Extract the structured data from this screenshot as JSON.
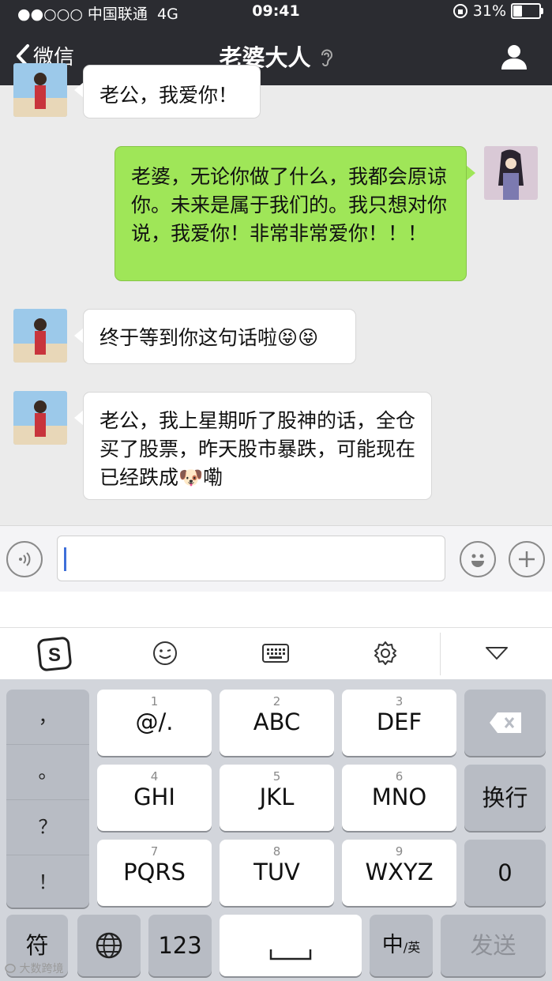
{
  "status_bar": {
    "carrier": "●●○○○ 中国联通",
    "network": "4G",
    "time": "09:41",
    "battery": "31%",
    "battery_level": 0.31
  },
  "nav": {
    "back_label": "微信",
    "title": "老婆大人"
  },
  "messages": [
    {
      "side": "in",
      "text": "老公，我爱你！"
    },
    {
      "side": "out",
      "text": "老婆，无论你做了什么，我都会原谅你。未来是属于我们的。我只想对你说，我爱你！非常非常爱你！！！"
    },
    {
      "side": "in",
      "text": "终于等到你这句话啦😝😝"
    },
    {
      "side": "in",
      "text": "老公，我上星期听了股神的话，全仓买了股票，昨天股市暴跌，可能现在已经跌成🐶嘞"
    }
  ],
  "ime_toolbar": {
    "icons": [
      "sogou-logo-icon",
      "smiley-icon",
      "keyboard-icon",
      "gear-icon",
      "collapse-triangle-icon"
    ]
  },
  "keyboard": {
    "side_punct": [
      "，",
      "。",
      "？",
      "！"
    ],
    "keys": [
      {
        "num": "1",
        "label": "@/."
      },
      {
        "num": "2",
        "label": "ABC"
      },
      {
        "num": "3",
        "label": "DEF"
      },
      {
        "num": "4",
        "label": "GHI"
      },
      {
        "num": "5",
        "label": "JKL"
      },
      {
        "num": "6",
        "label": "MNO"
      },
      {
        "num": "7",
        "label": "PQRS"
      },
      {
        "num": "8",
        "label": "TUV"
      },
      {
        "num": "9",
        "label": "WXYZ"
      }
    ],
    "enter_label": "换行",
    "zero_label": "0",
    "symbol_label": "符",
    "num_label": "123",
    "space_label": "␣",
    "lang_main": "中",
    "lang_sub": "/英",
    "send_label": "发送"
  },
  "watermark": "大数跨境"
}
